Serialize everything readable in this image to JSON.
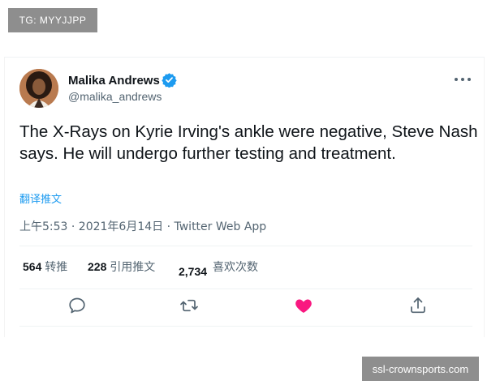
{
  "watermarks": {
    "top": "TG: MYYJJPP",
    "bottom": "ssl-crownsports.com"
  },
  "tweet": {
    "author_name": "Malika Andrews",
    "author_handle": "@malika_andrews",
    "verified": true,
    "text": "The X-Rays on Kyrie Irving's ankle were negative, Steve Nash says. He will undergo further testing and treatment.",
    "translate_label": "翻译推文",
    "meta": "上午5:53 · 2021年6月14日 · Twitter Web App",
    "stats": {
      "retweets_count": "564",
      "retweets_label": "转推",
      "quotes_count": "228",
      "quotes_label": "引用推文",
      "likes_count": "2,734",
      "likes_label": "喜欢次数"
    },
    "actions": {
      "reply": "reply-icon",
      "retweet": "retweet-icon",
      "like": "heart-icon",
      "share": "share-icon"
    },
    "colors": {
      "like_heart": "#f91880",
      "link": "#1d9bf0",
      "verified_badge": "#1d9bf0",
      "secondary_text": "#536471"
    }
  }
}
